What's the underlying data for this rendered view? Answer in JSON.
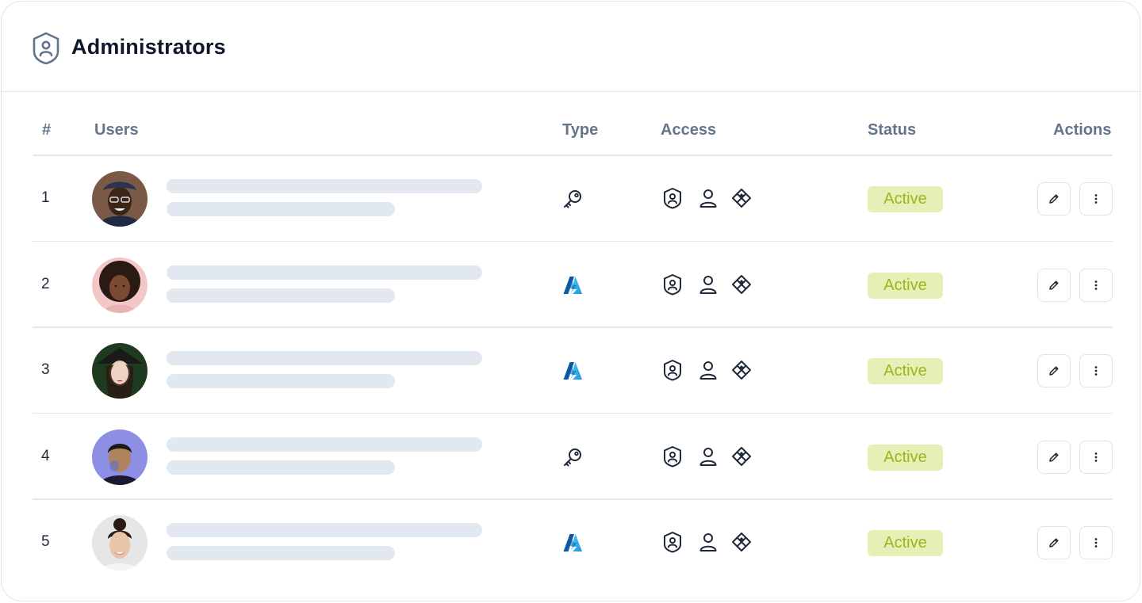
{
  "header": {
    "title": "Administrators",
    "icon": "shield-user-icon"
  },
  "columns": {
    "num": "#",
    "users": "Users",
    "type": "Type",
    "access": "Access",
    "status": "Status",
    "actions": "Actions"
  },
  "colors": {
    "status_bg": "#e6efb6",
    "status_text": "#9bb61d",
    "skeleton": "#e2e8f0",
    "azure_blue": "#0a72d6"
  },
  "rows": [
    {
      "num": "1",
      "type": "key-icon",
      "status": "Active",
      "access": [
        "shield-user-icon",
        "user-icon",
        "diamond-grid-icon"
      ]
    },
    {
      "num": "2",
      "type": "azure-icon",
      "status": "Active",
      "access": [
        "shield-user-icon",
        "user-icon",
        "diamond-grid-icon"
      ]
    },
    {
      "num": "3",
      "type": "azure-icon",
      "status": "Active",
      "access": [
        "shield-user-icon",
        "user-icon",
        "diamond-grid-icon"
      ]
    },
    {
      "num": "4",
      "type": "key-icon",
      "status": "Active",
      "access": [
        "shield-user-icon",
        "user-icon",
        "diamond-grid-icon"
      ]
    },
    {
      "num": "5",
      "type": "azure-icon",
      "status": "Active",
      "access": [
        "shield-user-icon",
        "user-icon",
        "diamond-grid-icon"
      ]
    }
  ]
}
